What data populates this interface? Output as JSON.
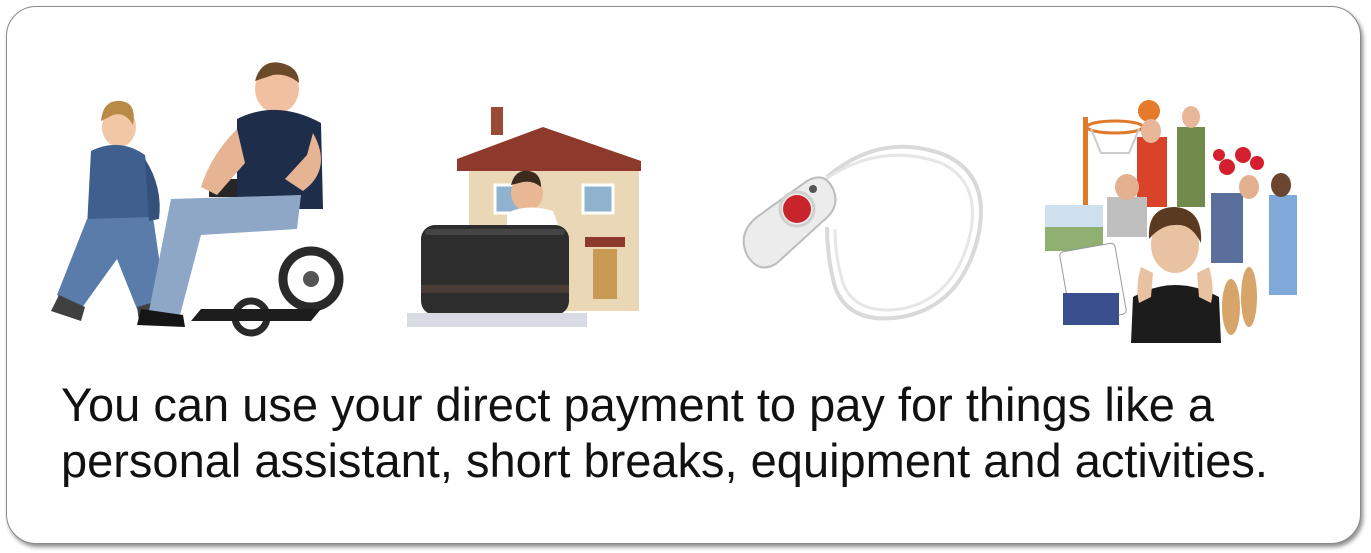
{
  "slide": {
    "caption_lines": [
      "You can use your direct payment to pay for things like a",
      "personal assistant, short breaks, equipment and activities."
    ]
  },
  "pictures": [
    {
      "id": "assistant",
      "icon": "personal-assistant-photo"
    },
    {
      "id": "short-breaks",
      "icon": "suitcase-house-photo"
    },
    {
      "id": "equipment",
      "icon": "alarm-pendant-photo"
    },
    {
      "id": "activities",
      "icon": "activities-collage-photo"
    }
  ],
  "colors": {
    "text": "#111111",
    "border": "#8a8a8a",
    "background": "#ffffff"
  }
}
